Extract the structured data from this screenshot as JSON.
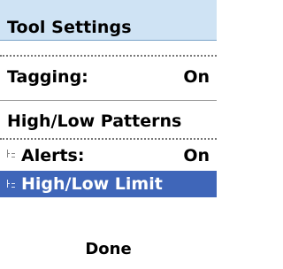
{
  "title": "Tool Settings",
  "tagging": {
    "label": "Tagging:",
    "value": "On"
  },
  "section_header": "High/Low Patterns",
  "sub_items": [
    {
      "label": "Alerts:",
      "value": "On",
      "selected": false
    },
    {
      "label": "High/Low Limit",
      "value": "",
      "selected": true
    }
  ],
  "done_label": "Done",
  "colors": {
    "title_bar_bg": "#cfe3f4",
    "selection_bg": "#3f66b9",
    "selection_text": "#ffffff"
  }
}
